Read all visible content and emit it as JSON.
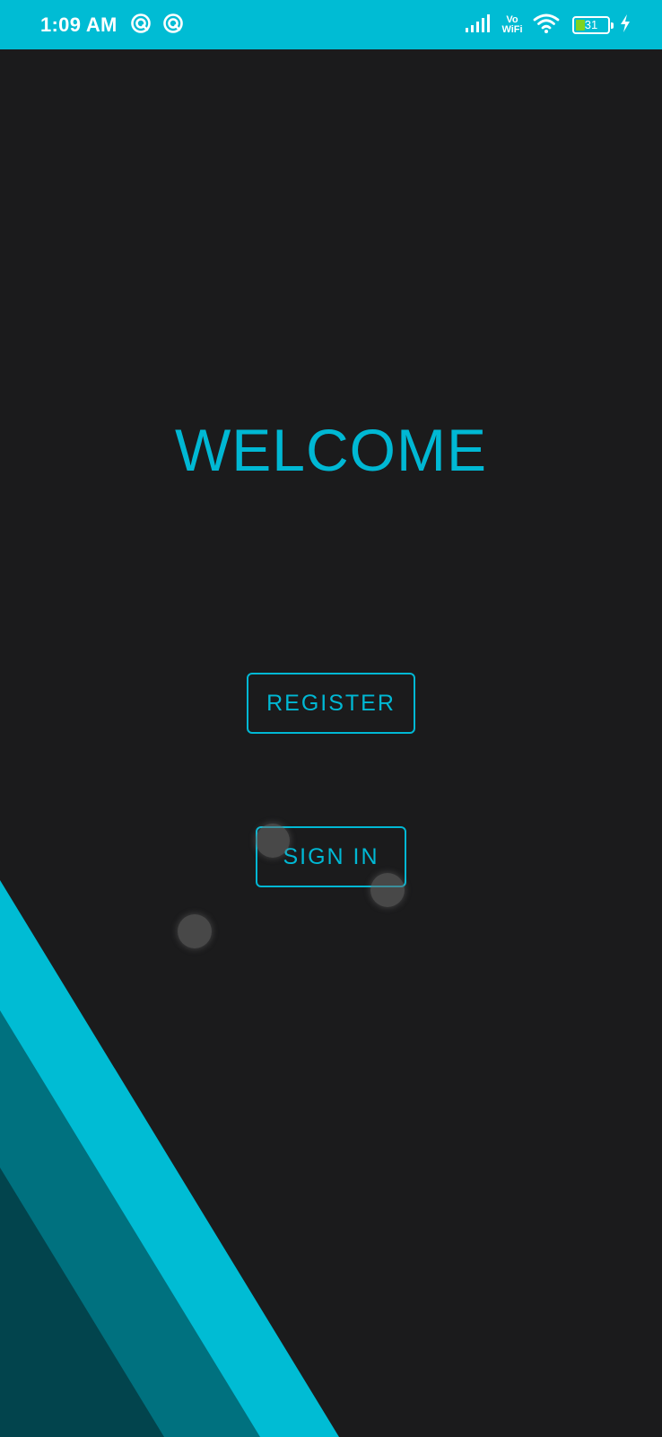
{
  "status_bar": {
    "time": "1:09 AM",
    "vowifi_top": "Vo",
    "vowifi_bottom": "WiFi",
    "battery_level": "31",
    "background_color": "#00bcd4",
    "icons": [
      "notification-circle-icon",
      "notification-circle-icon",
      "signal-bars-icon",
      "wifi-icon",
      "battery-icon",
      "charging-bolt-icon"
    ]
  },
  "main": {
    "title": "WELCOME",
    "register_label": "REGISTER",
    "signin_label": "SIGN IN",
    "accent_color": "#00b8d4",
    "background_color": "#1b1b1c"
  },
  "decor": {
    "stripe_colors": [
      "#00bcd4",
      "#00717f",
      "#02444d"
    ]
  }
}
